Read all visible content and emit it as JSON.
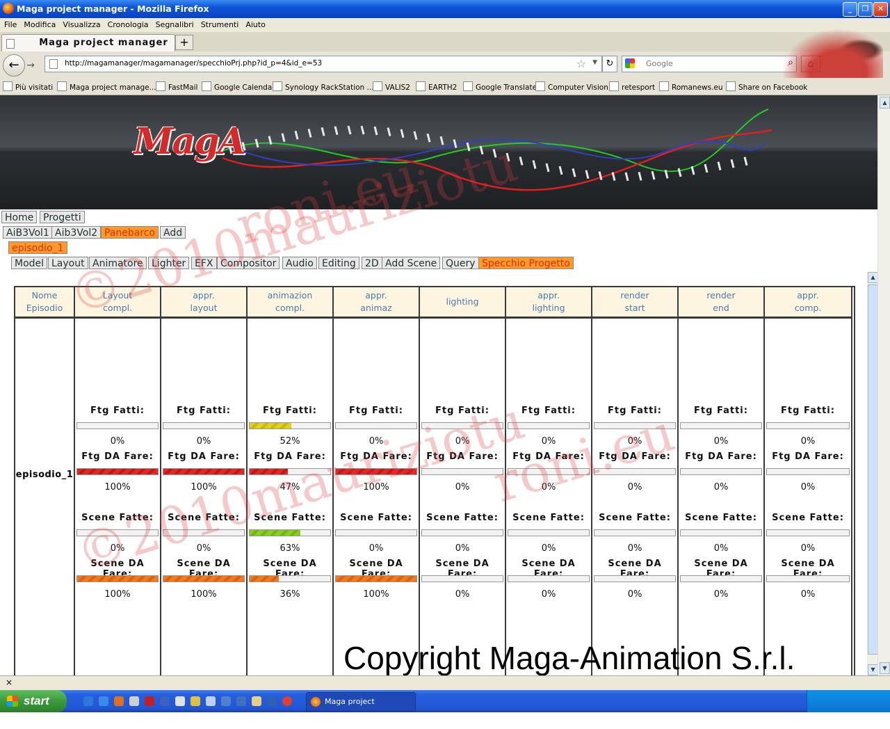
{
  "window": {
    "title": "Maga project manager - Mozilla Firefox"
  },
  "menu": [
    "File",
    "Modifica",
    "Visualizza",
    "Cronologia",
    "Segnalibri",
    "Strumenti",
    "Aiuto"
  ],
  "tab": {
    "label": "Maga project manager",
    "new_tab": "+"
  },
  "nav": {
    "url": "http://magamanager/magamanager/specchioPrj.php?id_p=4&id_e=53",
    "search_placeholder": "Google"
  },
  "bookmarks": [
    "Più visitati",
    "Maga project manage...",
    "FastMail",
    "Google Calendar",
    "Synology RackStation ...",
    "VALIS2",
    "EARTH2",
    "Google Translate",
    "Computer Vision",
    "retesport",
    "Romanews.eu",
    "Share on Facebook"
  ],
  "site": {
    "logo": "MagA",
    "nav_row1": [
      "Home",
      "Progetti"
    ],
    "nav_row2": [
      "AiB3Vol1",
      "Aib3Vol2",
      "Panebarco",
      "Add"
    ],
    "nav_row3": [
      "episodio_1"
    ],
    "nav_row4": [
      "Model",
      "Layout",
      "Animatore",
      "Lighter",
      "EFX",
      "Compositor",
      "Audio",
      "Editing",
      "2D",
      "Add Scene",
      "Query",
      "Specchio Progetto"
    ],
    "active": {
      "row2": "Panebarco",
      "row3": "episodio_1",
      "row4": "Specchio Progetto"
    }
  },
  "table": {
    "first_col_header": [
      "Nome",
      "Episodio"
    ],
    "episode": "episodio_1",
    "labels": {
      "ftg_fatti": "Ftg Fatti:",
      "ftg_da_fare": "Ftg DA Fare:",
      "scene_fatte": "Scene Fatte:",
      "scene_da_fare": "Scene DA Fare:"
    },
    "columns": [
      {
        "header": [
          "Layout",
          "compl."
        ],
        "ftg_fatti": "0%",
        "ftg_da_fare": "100%",
        "scene_fatte": "0%",
        "scene_da_fare": "100%",
        "ftg_fatti_fill": 0,
        "ftg_da_fare_fill": 100,
        "scene_fatte_fill": 0,
        "scene_da_fare_fill": 100
      },
      {
        "header": [
          "appr.",
          "layout"
        ],
        "ftg_fatti": "0%",
        "ftg_da_fare": "100%",
        "scene_fatte": "0%",
        "scene_da_fare": "100%",
        "ftg_fatti_fill": 0,
        "ftg_da_fare_fill": 100,
        "scene_fatte_fill": 0,
        "scene_da_fare_fill": 100
      },
      {
        "header": [
          "animazion",
          "compl."
        ],
        "ftg_fatti": "52%",
        "ftg_da_fare": "47%",
        "scene_fatte": "63%",
        "scene_da_fare": "36%",
        "ftg_fatti_fill": 52,
        "ftg_da_fare_fill": 47,
        "scene_fatte_fill": 63,
        "scene_da_fare_fill": 36
      },
      {
        "header": [
          "appr.",
          "animaz"
        ],
        "ftg_fatti": "0%",
        "ftg_da_fare": "100%",
        "scene_fatte": "0%",
        "scene_da_fare": "100%",
        "ftg_fatti_fill": 0,
        "ftg_da_fare_fill": 100,
        "scene_fatte_fill": 0,
        "scene_da_fare_fill": 100
      },
      {
        "header": [
          "lighting"
        ],
        "ftg_fatti": "0%",
        "ftg_da_fare": "0%",
        "scene_fatte": "0%",
        "scene_da_fare": "0%",
        "ftg_fatti_fill": 0,
        "ftg_da_fare_fill": 0,
        "scene_fatte_fill": 0,
        "scene_da_fare_fill": 0
      },
      {
        "header": [
          "appr.",
          "lighting"
        ],
        "ftg_fatti": "0%",
        "ftg_da_fare": "0%",
        "scene_fatte": "0%",
        "scene_da_fare": "0%",
        "ftg_fatti_fill": 0,
        "ftg_da_fare_fill": 0,
        "scene_fatte_fill": 0,
        "scene_da_fare_fill": 0
      },
      {
        "header": [
          "render",
          "start"
        ],
        "ftg_fatti": "0%",
        "ftg_da_fare": "0%",
        "scene_fatte": "0%",
        "scene_da_fare": "0%",
        "ftg_fatti_fill": 0,
        "ftg_da_fare_fill": 0,
        "scene_fatte_fill": 0,
        "scene_da_fare_fill": 0
      },
      {
        "header": [
          "render",
          "end"
        ],
        "ftg_fatti": "0%",
        "ftg_da_fare": "0%",
        "scene_fatte": "0%",
        "scene_da_fare": "0%",
        "ftg_fatti_fill": 0,
        "ftg_da_fare_fill": 0,
        "scene_fatte_fill": 0,
        "scene_da_fare_fill": 0
      },
      {
        "header": [
          "appr.",
          "comp."
        ],
        "ftg_fatti": "0%",
        "ftg_da_fare": "0%",
        "scene_fatte": "0%",
        "scene_da_fare": "0%",
        "ftg_fatti_fill": 0,
        "ftg_da_fare_fill": 0,
        "scene_fatte_fill": 0,
        "scene_da_fare_fill": 0
      }
    ]
  },
  "copyright": "Copyright Maga-Animation S.r.l.",
  "watermark": [
    "©2010mauriziotuроni.eu"
  ],
  "taskbar": {
    "start": "start",
    "task": "Maga project manage..."
  },
  "colors": {
    "active_tab": "#ff9a2a",
    "active_text": "#d63010",
    "header_bg": "#fdf5e0",
    "header_text": "#4a7ab0"
  }
}
